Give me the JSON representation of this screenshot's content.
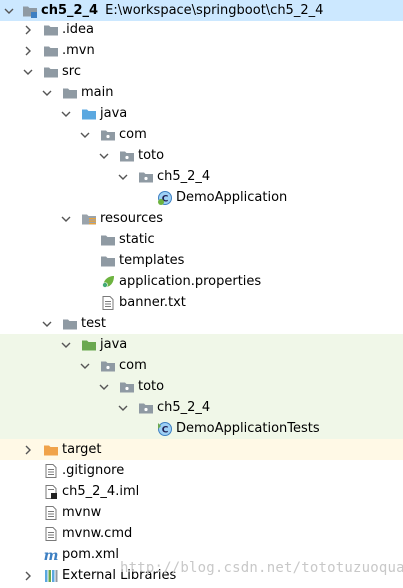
{
  "project": {
    "name": "ch5_2_4",
    "path": "E:\\workspace\\springboot\\ch5_2_4"
  },
  "tree": [
    {
      "label": "ch5_2_4",
      "path_label": "E:\\workspace\\springboot\\ch5_2_4",
      "icon": "module-folder-icon",
      "arrow": "expanded"
    },
    {
      "label": ".idea",
      "icon": "folder-icon",
      "arrow": "collapsed"
    },
    {
      "label": ".mvn",
      "icon": "folder-icon",
      "arrow": "collapsed"
    },
    {
      "label": "src",
      "icon": "folder-icon",
      "arrow": "expanded"
    },
    {
      "label": "main",
      "icon": "folder-icon",
      "arrow": "expanded"
    },
    {
      "label": "java",
      "icon": "source-folder-icon",
      "arrow": "expanded"
    },
    {
      "label": "com",
      "icon": "package-icon",
      "arrow": "expanded"
    },
    {
      "label": "toto",
      "icon": "package-icon",
      "arrow": "expanded"
    },
    {
      "label": "ch5_2_4",
      "icon": "package-icon",
      "arrow": "expanded"
    },
    {
      "label": "DemoApplication",
      "icon": "spring-boot-class-icon",
      "arrow": "none"
    },
    {
      "label": "resources",
      "icon": "resources-folder-icon",
      "arrow": "expanded"
    },
    {
      "label": "static",
      "icon": "folder-icon",
      "arrow": "none"
    },
    {
      "label": "templates",
      "icon": "folder-icon",
      "arrow": "none"
    },
    {
      "label": "application.properties",
      "icon": "spring-properties-icon",
      "arrow": "none"
    },
    {
      "label": "banner.txt",
      "icon": "text-file-icon",
      "arrow": "none"
    },
    {
      "label": "test",
      "icon": "folder-icon",
      "arrow": "expanded"
    },
    {
      "label": "java",
      "icon": "test-source-folder-icon",
      "arrow": "expanded"
    },
    {
      "label": "com",
      "icon": "package-icon",
      "arrow": "expanded"
    },
    {
      "label": "toto",
      "icon": "package-icon",
      "arrow": "expanded"
    },
    {
      "label": "ch5_2_4",
      "icon": "package-icon",
      "arrow": "expanded"
    },
    {
      "label": "DemoApplicationTests",
      "icon": "test-class-icon",
      "arrow": "none"
    },
    {
      "label": "target",
      "icon": "excluded-folder-icon",
      "arrow": "collapsed"
    },
    {
      "label": ".gitignore",
      "icon": "text-file-icon",
      "arrow": "none"
    },
    {
      "label": "ch5_2_4.iml",
      "icon": "iml-file-icon",
      "arrow": "none"
    },
    {
      "label": "mvnw",
      "icon": "text-file-icon",
      "arrow": "none"
    },
    {
      "label": "mvnw.cmd",
      "icon": "text-file-icon",
      "arrow": "none"
    },
    {
      "label": "pom.xml",
      "icon": "maven-icon",
      "arrow": "none"
    },
    {
      "label": "External Libraries",
      "icon": "libraries-icon",
      "arrow": "collapsed"
    }
  ],
  "watermark": "http://blog.csdn.net/tototuzuoquan",
  "colors": {
    "selection": "#cce8ff",
    "test_background": "#f0f7e8",
    "excluded_background": "#fff9e6",
    "folder": "#8f9aa3",
    "source_folder": "#5ba8e0",
    "test_folder": "#6aa84f",
    "resources_folder": "#9aa3ab",
    "excluded_folder": "#f0a34a",
    "spring_green": "#6db33f"
  }
}
